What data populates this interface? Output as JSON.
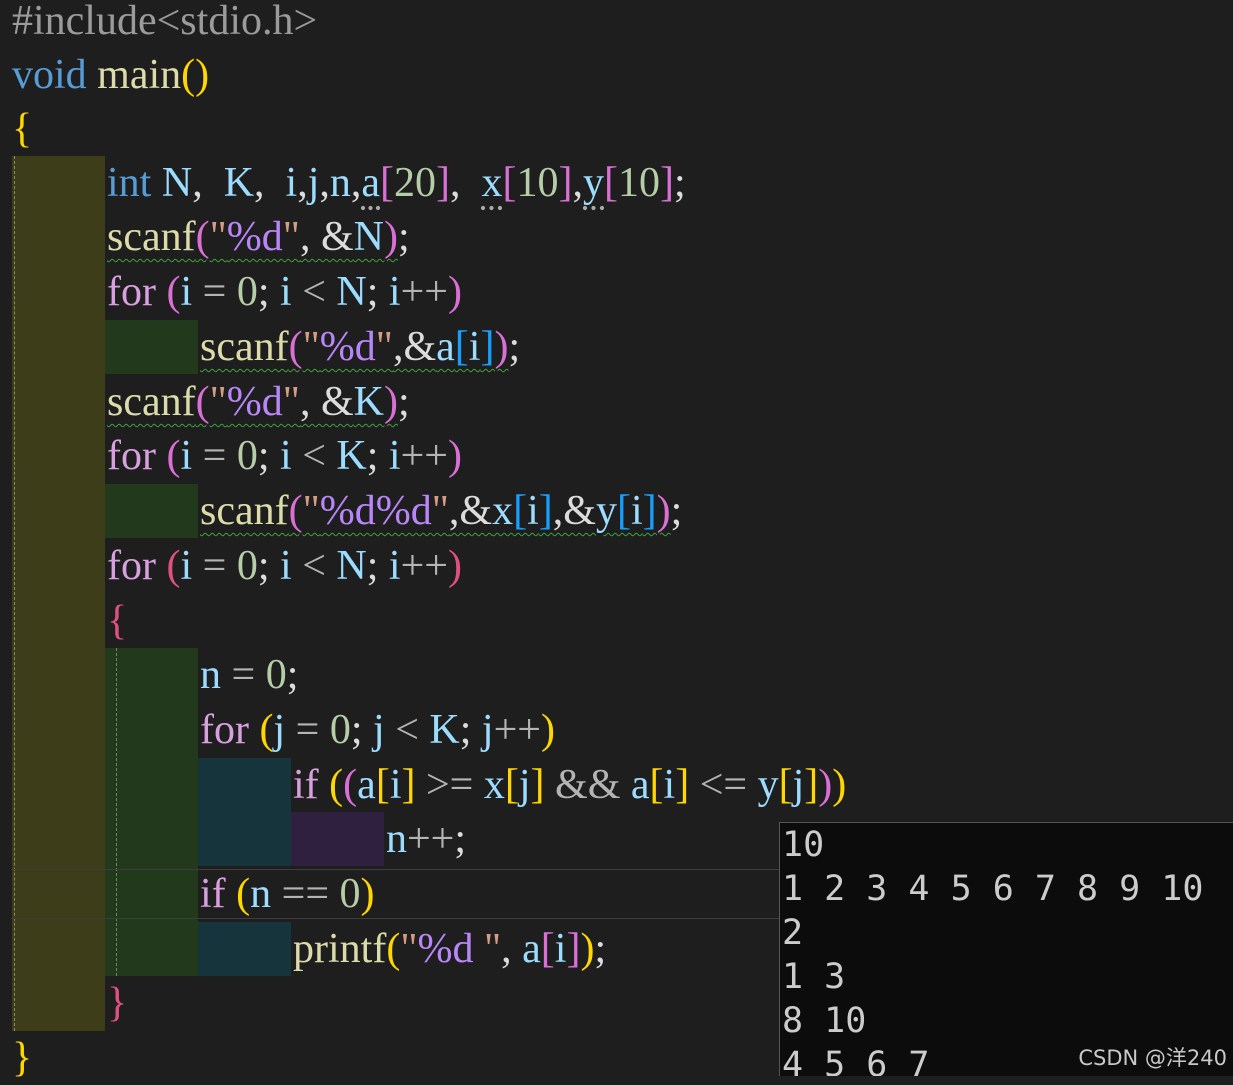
{
  "code": {
    "lines": [
      "#include<stdio.h>",
      "void main()",
      "{",
      "int N, K, i, j, n, a[20], x[10], y[10];",
      "scanf(\"%d\", &N);",
      "for (i = 0; i < N; i++)",
      "scanf(\"%d\",&a[i]);",
      "scanf(\"%d\", &K);",
      "for (i = 0; i < K; i++)",
      "scanf(\"%d%d\",&x[i],&y[i]);",
      "for (i = 0; i < N; i++)",
      "{",
      "n = 0;",
      "for (j = 0; j < K; j++)",
      "if ((a[i] >= x[j] && a[i] <= y[j]))",
      "n++;",
      "if (n == 0)",
      "printf(\"%d \", a[i]);",
      "}",
      "}"
    ]
  },
  "console": {
    "lines": [
      "10",
      "1 2 3 4 5 6 7 8 9 10",
      "2",
      "1 3",
      "8 10",
      "4 5 6 7"
    ]
  },
  "watermark": "CSDN @洋240",
  "colors": {
    "background": "#1e1e1e",
    "keyword": "#569cd6",
    "function": "#dcdcaa",
    "variable": "#9cdcfe",
    "control": "#d8a0df",
    "string": "#d69d85",
    "number": "#b5cea8"
  }
}
